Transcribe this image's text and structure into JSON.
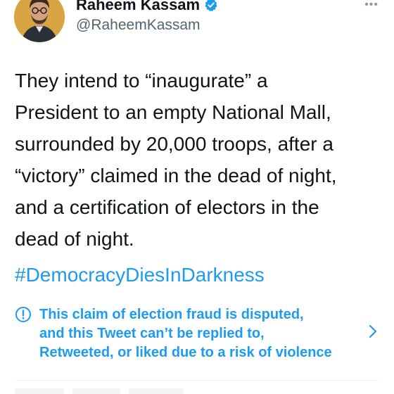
{
  "tweet": {
    "author": {
      "display_name": "Raheem Kassam",
      "handle": "@RaheemKassam",
      "verified": true
    },
    "text": "They intend to “inaugurate” a\nPresident to an empty National Mall,\nsurrounded by 20,000 troops, after a\n“victory” claimed in the dead of night,\nand a certification of electors in the\ndead of night.",
    "hashtag": "#DemocracyDiesInDarkness",
    "notice": "This claim of election fraud is disputed,\nand this Tweet can’t be replied to,\nRetweeted, or liked due to a risk of violence"
  },
  "icons": {
    "verified": "verified-badge-icon",
    "more": "more-options-icon",
    "notice": "info-circle-icon",
    "chevron": "chevron-right-icon"
  },
  "colors": {
    "accent": "#1d9bf0",
    "text": "#0f1419",
    "secondary": "#536471"
  }
}
